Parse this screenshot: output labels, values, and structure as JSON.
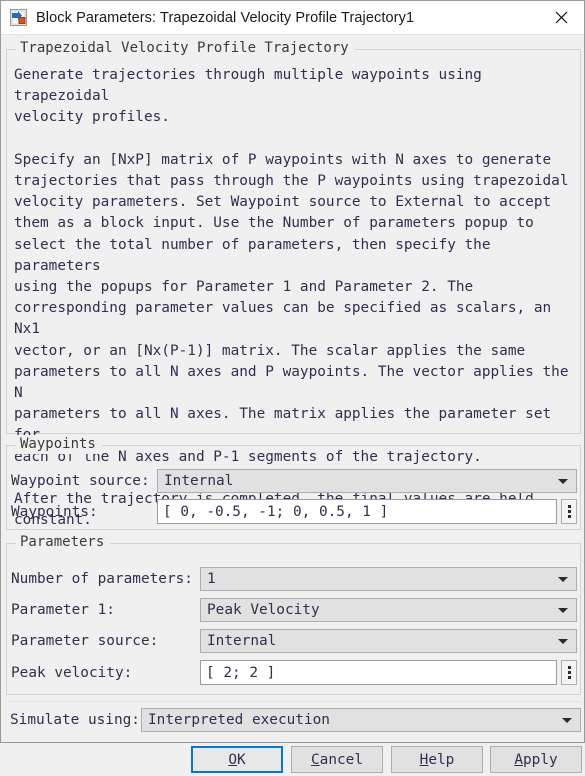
{
  "window": {
    "title": "Block Parameters: Trapezoidal Velocity Profile Trajectory1",
    "icon": "simulink-block-icon",
    "close_label": "✕"
  },
  "description": {
    "legend": "Trapezoidal Velocity Profile Trajectory",
    "paragraphs": [
      "Generate trajectories through multiple waypoints using trapezoidal\nvelocity profiles.",
      "Specify an [NxP] matrix of P waypoints with N axes to generate\ntrajectories that pass through the P waypoints using trapezoidal\nvelocity parameters. Set Waypoint source to External to accept\nthem as a block input. Use the Number of parameters popup to\nselect the total number of parameters, then specify the parameters\nusing the popups for Parameter 1 and Parameter 2. The\ncorresponding parameter values can be specified as scalars, an Nx1\nvector, or an [Nx(P-1)] matrix. The scalar applies the same\nparameters to all N axes and P waypoints. The vector applies the N\nparameters to all N axes. The matrix applies the parameter set for\neach of the N axes and P-1 segments of the trajectory.",
      "After the trajectory is completed, the final values are held\nconstant."
    ],
    "full_text": "Generate trajectories through multiple waypoints using trapezoidal\nvelocity profiles.\n\nSpecify an [NxP] matrix of P waypoints with N axes to generate\ntrajectories that pass through the P waypoints using trapezoidal\nvelocity parameters. Set Waypoint source to External to accept\nthem as a block input. Use the Number of parameters popup to\nselect the total number of parameters, then specify the parameters\nusing the popups for Parameter 1 and Parameter 2. The\ncorresponding parameter values can be specified as scalars, an Nx1\nvector, or an [Nx(P-1)] matrix. The scalar applies the same\nparameters to all N axes and P waypoints. The vector applies the N\nparameters to all N axes. The matrix applies the parameter set for\neach of the N axes and P-1 segments of the trajectory.\n\nAfter the trajectory is completed, the final values are held\nconstant."
  },
  "waypoints_group": {
    "legend": "Waypoints",
    "source_label": "Waypoint source:",
    "source_value": "Internal",
    "waypoints_label": "Waypoints:",
    "waypoints_value": "[ 0,  -0.5,  -1; 0,  0.5,  1 ]"
  },
  "parameters_group": {
    "legend": "Parameters",
    "number_label": "Number of parameters:",
    "number_value": "1",
    "param1_label": "Parameter 1:",
    "param1_value": "Peak Velocity",
    "source_label": "Parameter source:",
    "source_value": "Internal",
    "peak_label": "Peak velocity:",
    "peak_value": "[ 2; 2 ]"
  },
  "simulate": {
    "label": "Simulate using:",
    "value": "Interpreted execution"
  },
  "buttons": [
    {
      "name": "ok",
      "mnemonic": "O",
      "before": "",
      "after": "K",
      "focused": true
    },
    {
      "name": "cancel",
      "mnemonic": "C",
      "before": "",
      "after": "ancel",
      "focused": false
    },
    {
      "name": "help",
      "mnemonic": "H",
      "before": "",
      "after": "elp",
      "focused": false
    },
    {
      "name": "apply",
      "mnemonic": "A",
      "before": "",
      "after": "pply",
      "focused": false
    }
  ],
  "colors": {
    "dialog_bg": "#f0f0f0",
    "titlebar_bg": "#ffffff",
    "text": "#2f2f4f",
    "field_bg": "#ffffff",
    "combo_bg": "#e1e1e1",
    "border": "#adadad",
    "focus_accent": "#0078d7"
  }
}
